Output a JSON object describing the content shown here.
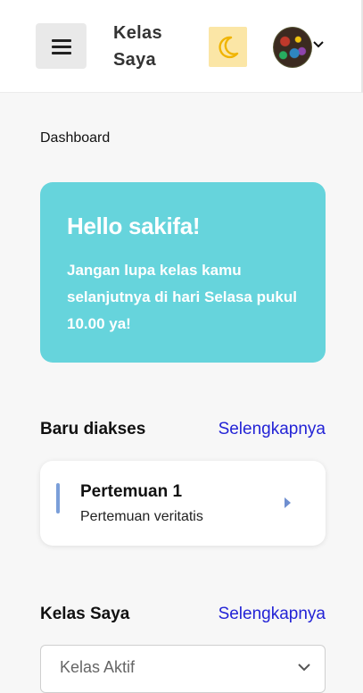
{
  "header": {
    "menu_icon": "hamburger-menu-icon",
    "title": "Kelas Saya",
    "theme_icon": "moon-icon",
    "theme_color": "#fbe6a6",
    "avatar_icon": "user-avatar",
    "avatar_chevron_icon": "chevron-down-icon"
  },
  "breadcrumb": "Dashboard",
  "welcome": {
    "title": "Hello sakifa!",
    "message": "Jangan lupa kelas kamu selanjutnya di hari Selasa pukul 10.00 ya!",
    "background": "#66d4dc"
  },
  "recent": {
    "title": "Baru diakses",
    "more_label": "Selengkapnya",
    "items": [
      {
        "name": "Pertemuan 1",
        "description": "Pertemuan veritatis",
        "arrow_icon": "caret-right-icon"
      }
    ]
  },
  "my_classes": {
    "title": "Kelas Saya",
    "more_label": "Selengkapnya",
    "filter": {
      "selected": "Kelas Aktif",
      "chevron_icon": "chevron-down-icon"
    }
  },
  "colors": {
    "link": "#2323d6",
    "accent_bar": "#7b9fd9"
  }
}
